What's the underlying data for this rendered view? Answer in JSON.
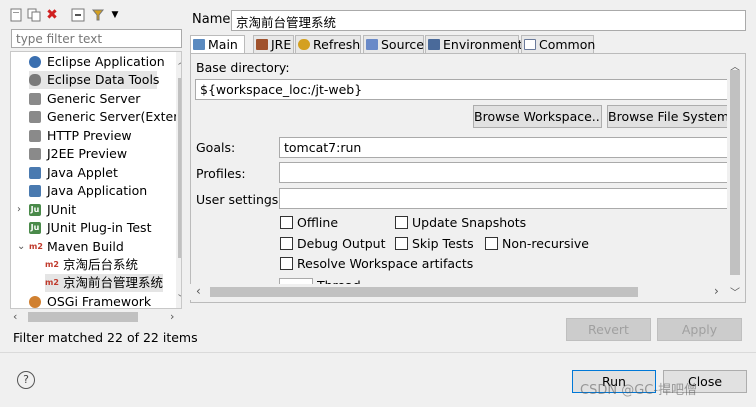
{
  "left_panel": {
    "toolbar_icons": [
      "new-config-icon",
      "duplicate-icon",
      "delete-icon",
      "collapse-all-icon",
      "filter-icon",
      "menu-dropdown-icon"
    ],
    "filter_placeholder": "type filter text",
    "tree": [
      {
        "label": "Eclipse Application",
        "icon": "eclipse-app-icon",
        "color": "#3a6fb0"
      },
      {
        "label": "Eclipse Data Tools",
        "icon": "data-tools-icon",
        "color": "#7a7a7a"
      },
      {
        "label": "Generic Server",
        "icon": "server-icon",
        "color": "#8a8a8a"
      },
      {
        "label": "Generic Server(Exter",
        "icon": "server-icon",
        "color": "#8a8a8a"
      },
      {
        "label": "HTTP Preview",
        "icon": "server-icon",
        "color": "#8a8a8a"
      },
      {
        "label": "J2EE Preview",
        "icon": "server-icon",
        "color": "#8a8a8a"
      },
      {
        "label": "Java Applet",
        "icon": "java-applet-icon",
        "color": "#4a7ab0"
      },
      {
        "label": "Java Application",
        "icon": "java-app-icon",
        "color": "#4a7ab0"
      },
      {
        "label": "JUnit",
        "icon": "junit-icon",
        "color": "#4a8a4a"
      },
      {
        "label": "JUnit Plug-in Test",
        "icon": "junit-plugin-icon",
        "color": "#4a8a4a"
      },
      {
        "label": "Maven Build",
        "icon": "maven-icon",
        "color": "#c0392b"
      },
      {
        "label": "京淘后台系统",
        "icon": "maven-icon",
        "color": "#c0392b"
      },
      {
        "label": "京淘前台管理系统",
        "icon": "maven-icon",
        "color": "#c0392b"
      },
      {
        "label": "OSGi Framework",
        "icon": "osgi-icon",
        "color": "#d08030"
      }
    ],
    "filter_status": "Filter matched 22 of 22 items"
  },
  "config": {
    "name_label": "Name:",
    "name_value": "京淘前台管理系统",
    "tabs": [
      {
        "label": "Main",
        "icon": "main-tab-icon",
        "color": "#5a8ac0"
      },
      {
        "label": "JRE",
        "icon": "jre-tab-icon",
        "color": "#a0522d"
      },
      {
        "label": "Refresh",
        "icon": "refresh-tab-icon",
        "color": "#d4a020"
      },
      {
        "label": "Source",
        "icon": "source-tab-icon",
        "color": "#6a8ac8"
      },
      {
        "label": "Environment",
        "icon": "environment-tab-icon",
        "color": "#4a6a9a"
      },
      {
        "label": "Common",
        "icon": "common-tab-icon",
        "color": "#6a7a9a"
      }
    ],
    "base_dir_label": "Base directory:",
    "base_dir_value": "${workspace_loc:/jt-web}",
    "browse_workspace": "Browse Workspace...",
    "browse_filesystem": "Browse File System...",
    "goals_label": "Goals:",
    "goals_value": "tomcat7:run",
    "profiles_label": "Profiles:",
    "profiles_value": "",
    "user_settings_label": "User settings:",
    "user_settings_value": "",
    "checkboxes": {
      "offline": "Offline",
      "update_snapshots": "Update Snapshots",
      "debug_output": "Debug Output",
      "skip_tests": "Skip Tests",
      "non_recursive": "Non-recursive",
      "resolve_workspace": "Resolve Workspace artifacts"
    },
    "threads_partial": "Thread",
    "revert": "Revert",
    "apply": "Apply"
  },
  "footer": {
    "help_icon": "help-icon",
    "run": "Run",
    "close": "Close",
    "watermark": "CSDN @GC-捍吧僧"
  }
}
